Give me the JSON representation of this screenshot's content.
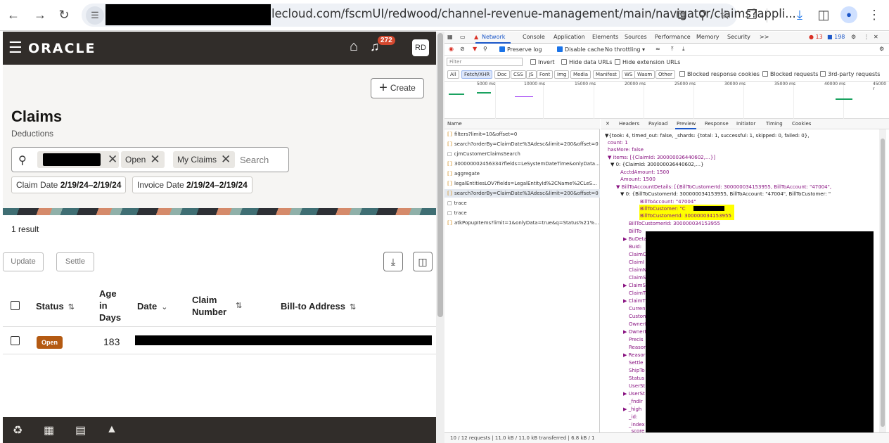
{
  "browser": {
    "url_text": "lecloud.com/fscmUI/redwood/channel-revenue-management/main/navigator/claims?appli...",
    "icons": [
      "back-arrow-icon",
      "forward-arrow-icon",
      "reload-icon",
      "site-settings-icon",
      "install-icon",
      "zoom-icon",
      "bookmark-star-icon",
      "extensions-icon",
      "download-icon",
      "side-panel-icon",
      "profile-icon",
      "more-vert-icon"
    ]
  },
  "app": {
    "logo": "ORACLE",
    "notification_count": "272",
    "user_initials": "RD",
    "create_label": "Create",
    "page_title": "Claims",
    "page_subtitle": "Deductions",
    "search": {
      "chips": [
        "Open",
        "My Claims"
      ],
      "placeholder": "Search"
    },
    "filters": [
      {
        "label": "Claim Date",
        "value": "2/19/24–2/19/24"
      },
      {
        "label": "Invoice Date",
        "value": "2/19/24–2/19/24"
      }
    ],
    "result_count": "1 result",
    "update_label": "Update",
    "settle_label": "Settle",
    "columns": {
      "status": "Status",
      "age_1": "Age",
      "age_2": "in",
      "age_3": "Days",
      "date": "Date",
      "claim_1": "Claim",
      "claim_2": "Number",
      "bill_to": "Bill-to Address"
    },
    "rows": [
      {
        "status": "Open",
        "age": "183"
      }
    ]
  },
  "devtools": {
    "tabs": [
      "Network",
      "Console",
      "Application",
      "Elements",
      "Sources",
      "Performance",
      "Memory",
      "Security",
      ">>"
    ],
    "errors": "13",
    "messages": "198",
    "preserve_log": "Preserve log",
    "disable_cache": "Disable cache",
    "throttling": "No throttling",
    "filter_placeholder": "Filter",
    "invert": "Invert",
    "hide_data_urls": "Hide data URLs",
    "hide_ext_urls": "Hide extension URLs",
    "type_filters": [
      "All",
      "Fetch/XHR",
      "Doc",
      "CSS",
      "JS",
      "Font",
      "Img",
      "Media",
      "Manifest",
      "WS",
      "Wasm",
      "Other"
    ],
    "blocked_cookies": "Blocked response cookies",
    "blocked_requests": "Blocked requests",
    "third_party": "3rd-party requests",
    "timeline_marks": [
      "5000 ms",
      "10000 ms",
      "15000 ms",
      "20000 ms",
      "25000 ms",
      "30000 ms",
      "35000 ms",
      "40000 ms",
      "45000 r"
    ],
    "name_header": "Name",
    "requests": [
      "filters?limit=10&offset=0",
      "search?orderBy=ClaimDate%3Adesc&limit=200&offset=0",
      "cjmCustomerClaimsSearch",
      "300000002456334?fields=LeSystemDateTime&onlyData...",
      "aggregate",
      "legalEntitiesLOV?fields=LegalEntityId%2CName%2CLeS...",
      "search?orderBy=ClaimDate%3Adesc&limit=200&offset=0",
      "trace",
      "trace",
      "atkPopupItems?limit=1&onlyData=true&q=Status%21%..."
    ],
    "panel_tabs": [
      "Headers",
      "Payload",
      "Preview",
      "Response",
      "Initiator",
      "Timing",
      "Cookies"
    ],
    "preview_lines": [
      "▼{took: 4, timed_out: false, _shards: {total: 1, successful: 1, skipped: 0, failed: 0},",
      "count: 1",
      "hasMore: false",
      "▼ items: [{ClaimId: 300000036440602,…}]",
      "▼ 0: {ClaimId: 300000036440602,…}",
      "AcctdAmount: 1500",
      "Amount: 1500",
      "▼ BillToAccountDetails: [{BillToCustomerId: 300000034153955, BillToAccount: \"47004\",",
      "▼ 0: {BillToCustomerId: 300000034153955, BillToAccount: \"47004\", BillToCustomer: \"",
      "BillToAccount: \"47004\"",
      "BillToCustomer: \"C",
      "BillToCustomerId: 300000034153955",
      "BillToCustomerId: 300000034153955",
      "BillTo",
      "▶ BuDeta",
      "BuId:",
      "ClaimC",
      "ClaimI",
      "ClaimN",
      "ClaimS",
      "▶ ClaimS",
      "ClaimT",
      "▶ ClaimT",
      "Curren",
      "Custom",
      "OwnerI",
      "▶ OwnerI",
      "Precis",
      "Reasor",
      "▶ Reasor",
      "Settle",
      "ShipTo",
      "Status",
      "UserSt",
      "▶ UserSt",
      "_fndIr",
      "▶ _high",
      "_id:",
      "_index",
      "_score"
    ],
    "status_bar": "10 / 12 requests  |  11.0 kB / 11.0 kB transferred  |  6.8 kB / 1"
  }
}
